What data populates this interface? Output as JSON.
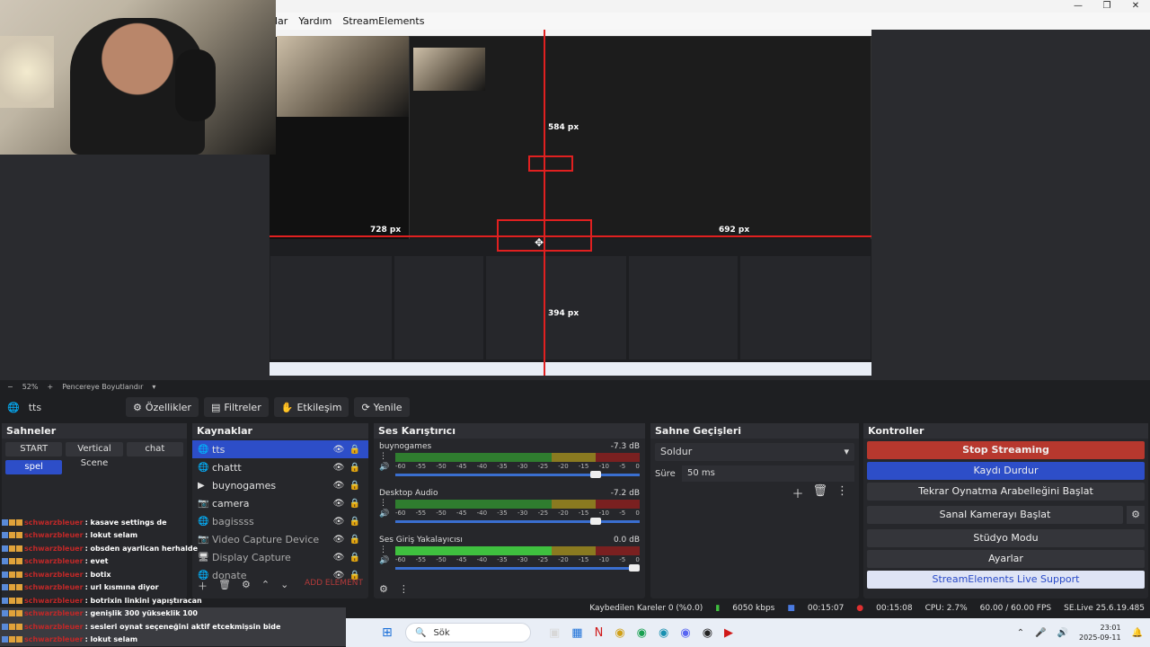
{
  "window": {
    "minimize": "—",
    "maximize": "❐",
    "close": "✕"
  },
  "menubar": [
    "lar",
    "Yardım",
    "StreamElements"
  ],
  "preview": {
    "labels": {
      "px584": "584 px",
      "px728": "728 px",
      "px692": "692 px",
      "px394": "394 px"
    },
    "zoom": "52%",
    "zoom_plus": "+",
    "zoom_minus": "−",
    "fit_label": "Pencereye Boyutlandır"
  },
  "toolbar": {
    "source_name": "tts",
    "properties": "Özellikler",
    "filters": "Filtreler",
    "interact": "Etkileşim",
    "refresh": "Yenile"
  },
  "scenes": {
    "title": "Sahneler",
    "items": [
      {
        "label": "START",
        "active": false
      },
      {
        "label": "Vertical Scene",
        "active": false
      },
      {
        "label": "chat",
        "active": false
      },
      {
        "label": "spel",
        "active": true
      }
    ]
  },
  "sources": {
    "title": "Kaynaklar",
    "items": [
      {
        "label": "tts",
        "icon": "🌐",
        "active": true,
        "dim": false
      },
      {
        "label": "chattt",
        "icon": "🌐",
        "active": false,
        "dim": false
      },
      {
        "label": "buynogames",
        "icon": "▶",
        "active": false,
        "dim": false
      },
      {
        "label": "camera",
        "icon": "📷",
        "active": false,
        "dim": false
      },
      {
        "label": "bagissss",
        "icon": "🌐",
        "active": false,
        "dim": true
      },
      {
        "label": "Video Capture Device",
        "icon": "📷",
        "active": false,
        "dim": true
      },
      {
        "label": "Display Capture",
        "icon": "🖥",
        "active": false,
        "dim": true
      },
      {
        "label": "donate",
        "icon": "🌐",
        "active": false,
        "dim": true
      }
    ],
    "add_element": "ADD ELEMENT"
  },
  "mixer": {
    "title": "Ses Karıştırıcı",
    "scale": [
      "-60",
      "-55",
      "-50",
      "-45",
      "-40",
      "-35",
      "-30",
      "-25",
      "-20",
      "-15",
      "-10",
      "-5",
      "0"
    ],
    "channels": [
      {
        "name": "buynogames",
        "db": "-7.3 dB",
        "fader": 0.82,
        "bright": false
      },
      {
        "name": "Desktop Audio",
        "db": "-7.2 dB",
        "fader": 0.82,
        "bright": false
      },
      {
        "name": "Ses Giriş Yakalayıcısı",
        "db": "0.0 dB",
        "fader": 0.98,
        "bright": true
      }
    ]
  },
  "transitions": {
    "title": "Sahne Geçişleri",
    "selected": "Soldur",
    "duration_label": "Süre",
    "duration_value": "50 ms"
  },
  "controls": {
    "title": "Kontroller",
    "stop_streaming": "Stop Streaming",
    "stop_recording": "Kaydı Durdur",
    "replay_buffer": "Tekrar Oynatma Arabelleğini Başlat",
    "virtual_camera": "Sanal Kamerayı Başlat",
    "studio_mode": "Stüdyo Modu",
    "settings": "Ayarlar",
    "se_support": "StreamElements Live Support"
  },
  "chat": [
    {
      "user": "schwarzbleuer",
      "msg": ": kasave settings de"
    },
    {
      "user": "schwarzbleuer",
      "msg": ": lokut selam"
    },
    {
      "user": "schwarzbleuer",
      "msg": ": obsden ayarlican herhalde"
    },
    {
      "user": "schwarzbleuer",
      "msg": ": evet"
    },
    {
      "user": "schwarzbleuer",
      "msg": ": botix"
    },
    {
      "user": "schwarzbleuer",
      "msg": ": url kısmına diyor"
    },
    {
      "user": "schwarzbleuer",
      "msg": ": botrixin linkini yapıştıracan"
    },
    {
      "user": "schwarzbleuer",
      "msg": ": genişlik 300 yükseklik 100"
    },
    {
      "user": "schwarzbleuer",
      "msg": ": sesleri oynat seçeneğini aktif etcekmişsin bide"
    },
    {
      "user": "schwarzbleuer",
      "msg": ": lokut selam"
    }
  ],
  "status": {
    "dropped": "Kaybedilen Kareler 0 (%0.0)",
    "bitrate": "6050 kbps",
    "stream_time": "00:15:07",
    "rec_time": "00:15:08",
    "cpu": "CPU: 2.7%",
    "fps": "60.00 / 60.00 FPS",
    "version": "SE.Live 25.6.19.485"
  },
  "taskbar": {
    "search": "Sök",
    "time": "23:01",
    "date": "2025-09-11"
  },
  "colors": {
    "accent": "#2d4ec8",
    "stop": "#b7382e",
    "chat_user": "#c02828"
  }
}
